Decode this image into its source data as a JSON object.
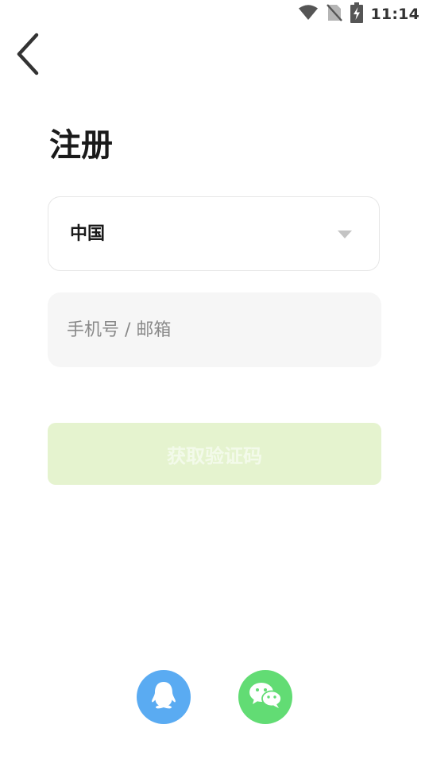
{
  "status_bar": {
    "time": "11:14",
    "icons": [
      "wifi-icon",
      "no-sim-icon",
      "battery-charging-icon"
    ]
  },
  "header": {
    "back_icon": "chevron-left-icon",
    "title": "注册"
  },
  "form": {
    "region": {
      "value": "中国",
      "caret_icon": "caret-down-icon"
    },
    "account": {
      "value": "",
      "placeholder": "手机号 / 邮箱"
    },
    "get_code_label": "获取验证码"
  },
  "social": {
    "icons": [
      "qq-icon",
      "wechat-icon"
    ]
  },
  "colors": {
    "qq": "#5aabf2",
    "wechat": "#62dc74",
    "disabled_button_bg": "#e5f3cf",
    "field_bg": "#f6f6f6",
    "border": "#e6e6e6"
  }
}
